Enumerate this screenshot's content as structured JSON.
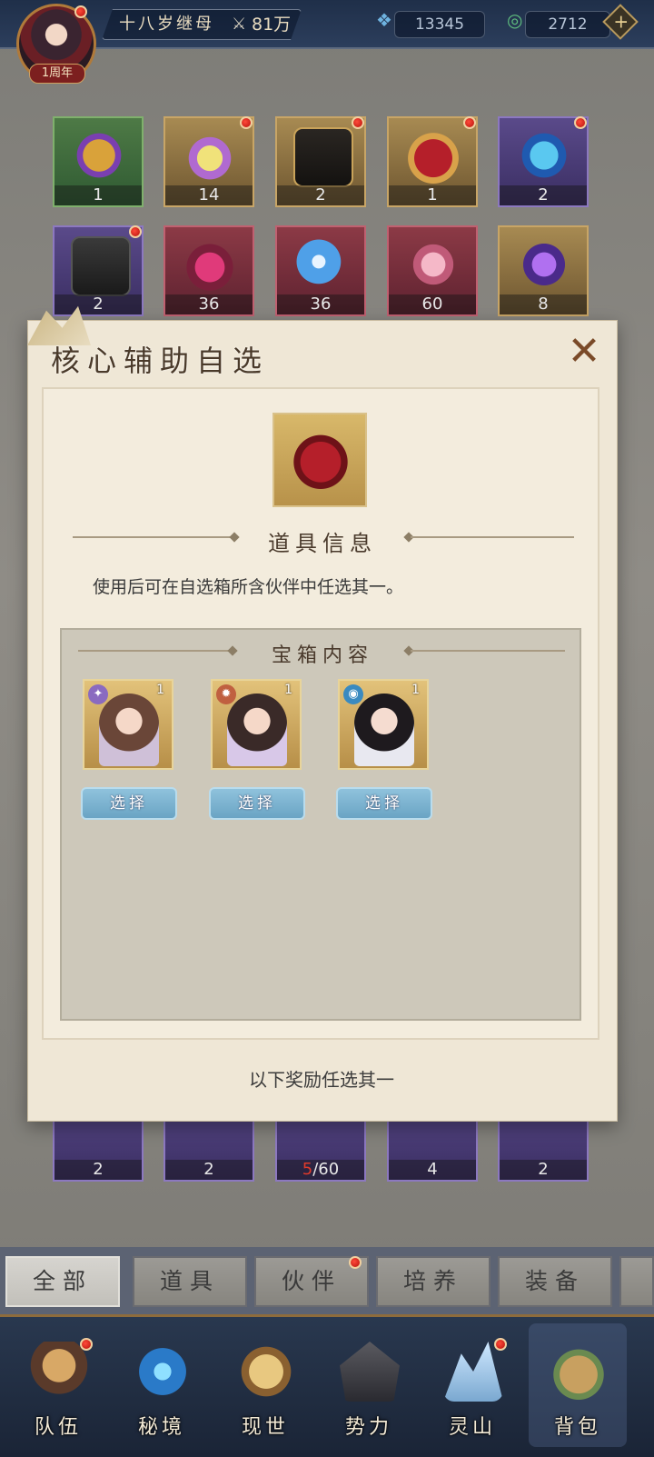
{
  "top_bar": {
    "player_name": "十八岁继母",
    "power": "81万",
    "avatar_badge": "1周年",
    "currency_gem": "13345",
    "currency_jade": "2712",
    "plus_label": "+"
  },
  "items_top": [
    {
      "count": "1"
    },
    {
      "count": "14"
    },
    {
      "count": "2"
    },
    {
      "count": "1"
    },
    {
      "count": "2"
    },
    {
      "count": "2"
    },
    {
      "count": "36"
    },
    {
      "count": "36"
    },
    {
      "count": "60"
    },
    {
      "count": "8"
    }
  ],
  "items_bottom": [
    {
      "count": "2"
    },
    {
      "count": "2"
    },
    {
      "count_have": "5",
      "count_need": "/60"
    },
    {
      "count": "4"
    },
    {
      "count": "2"
    }
  ],
  "modal": {
    "title": "核心辅助自选",
    "close_label": "✕",
    "item_info_title": "道具信息",
    "description": "使用后可在自选箱所含伙伴中任选其一。",
    "contents_title": "宝箱内容",
    "partners": [
      {
        "level": "1",
        "element": "✦",
        "select_label": "选择"
      },
      {
        "level": "1",
        "element": "✹",
        "select_label": "选择"
      },
      {
        "level": "1",
        "element": "◉",
        "select_label": "选择"
      }
    ],
    "footer": "以下奖励任选其一"
  },
  "tabs": [
    {
      "label": "全部"
    },
    {
      "label": "道具"
    },
    {
      "label": "伙伴"
    },
    {
      "label": "培养"
    },
    {
      "label": "装备"
    }
  ],
  "bottom_nav": [
    {
      "label": "队伍"
    },
    {
      "label": "秘境"
    },
    {
      "label": "现世"
    },
    {
      "label": "势力"
    },
    {
      "label": "灵山"
    },
    {
      "label": "背包"
    }
  ]
}
